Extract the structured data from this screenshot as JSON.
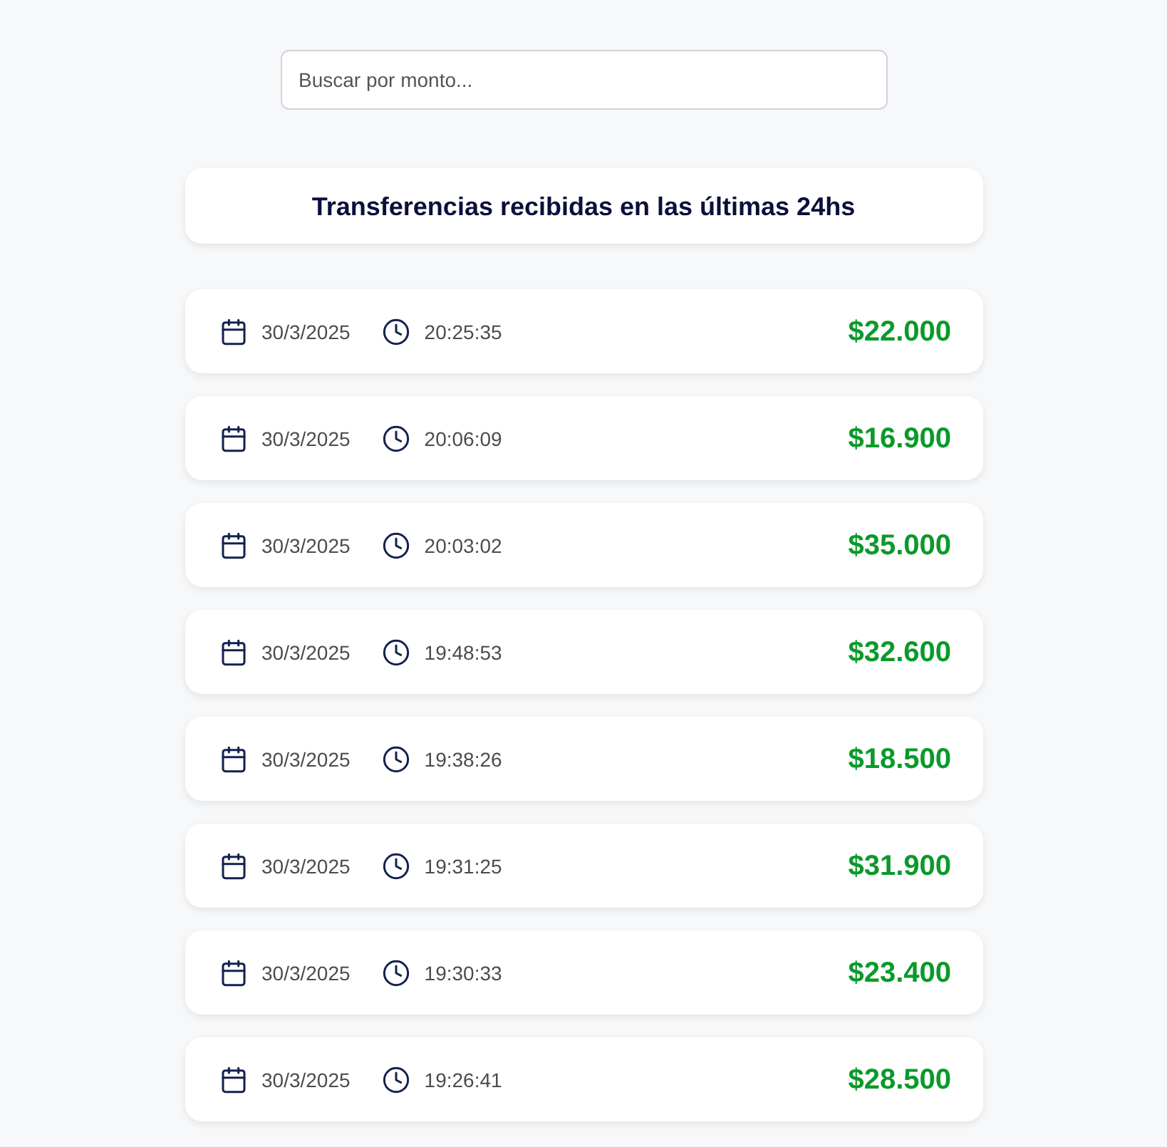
{
  "search": {
    "placeholder": "Buscar por monto..."
  },
  "title": "Transferencias recibidas en las últimas 24hs",
  "transfers": [
    {
      "date": "30/3/2025",
      "time": "20:25:35",
      "amount": "$22.000"
    },
    {
      "date": "30/3/2025",
      "time": "20:06:09",
      "amount": "$16.900"
    },
    {
      "date": "30/3/2025",
      "time": "20:03:02",
      "amount": "$35.000"
    },
    {
      "date": "30/3/2025",
      "time": "19:48:53",
      "amount": "$32.600"
    },
    {
      "date": "30/3/2025",
      "time": "19:38:26",
      "amount": "$18.500"
    },
    {
      "date": "30/3/2025",
      "time": "19:31:25",
      "amount": "$31.900"
    },
    {
      "date": "30/3/2025",
      "time": "19:30:33",
      "amount": "$23.400"
    },
    {
      "date": "30/3/2025",
      "time": "19:26:41",
      "amount": "$28.500"
    }
  ]
}
